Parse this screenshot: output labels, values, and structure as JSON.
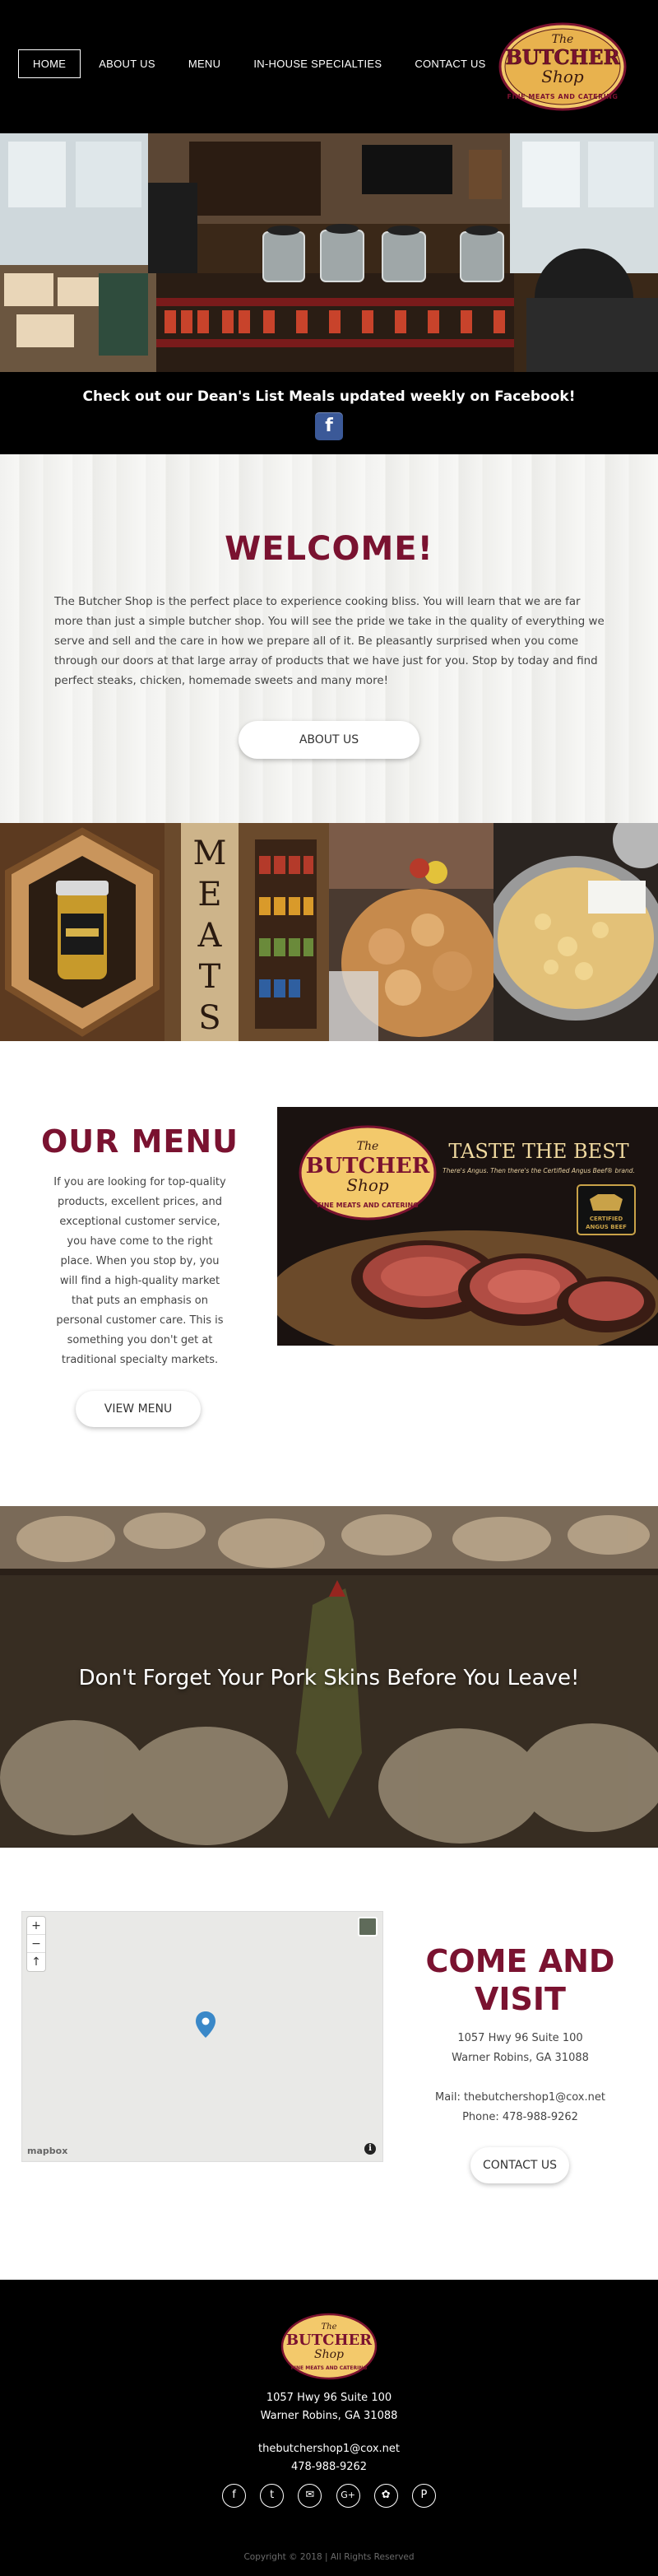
{
  "nav": {
    "items": [
      {
        "label": "HOME",
        "active": true
      },
      {
        "label": "ABOUT US",
        "active": false
      },
      {
        "label": "MENU",
        "active": false
      },
      {
        "label": "IN-HOUSE SPECIALTIES",
        "active": false
      },
      {
        "label": "CONTACT US",
        "active": false
      }
    ]
  },
  "logo": {
    "the": "The",
    "butcher": "BUTCHER",
    "shop": "Shop",
    "tagline": "FINE MEATS AND CATERING"
  },
  "announcement": {
    "text": "Check out our Dean's List Meals updated weekly on Facebook!",
    "facebook_glyph": "f"
  },
  "welcome": {
    "title": "WELCOME!",
    "body": "The Butcher Shop is the perfect place to experience cooking bliss. You will learn that we are far more than just a simple butcher shop. You will see the pride we take in the quality of everything we serve and sell and the care in how we prepare all of it. Be pleasantly surprised when you come through our doors at that large array of products that we have just for you. Stop by today and find perfect steaks, chicken, homemade sweets and many more!",
    "button": "ABOUT US"
  },
  "gallery": {
    "meats_letters": [
      "M",
      "E",
      "A",
      "T",
      "S"
    ]
  },
  "menu_section": {
    "title": "OUR MENU",
    "body": "If you are looking for top-quality products, excellent prices, and exceptional customer service, you have come to the right place. When you stop by, you will find a high-quality market that puts an emphasis on personal customer care. This is something you don't get at traditional specialty markets.",
    "button": "VIEW MENU",
    "banner": {
      "headline": "TASTE THE BEST",
      "subline": "There's Angus. Then there's the Certified Angus Beef® brand.",
      "badge_line1": "CERTIFIED",
      "badge_line2": "ANGUS BEEF"
    }
  },
  "pork": {
    "text": "Don't Forget Your Pork Skins Before You Leave!"
  },
  "visit": {
    "title_line1": "COME AND",
    "title_line2": "VISIT",
    "address_line1": "1057 Hwy 96 Suite 100",
    "address_line2": "Warner Robins, GA  31088",
    "mail": "Mail: thebutchershop1@cox.net",
    "phone": "Phone: 478-988-9262",
    "button": "CONTACT US",
    "map": {
      "zoom_in": "+",
      "zoom_out": "−",
      "compass": "↑",
      "attribution": "mapbox",
      "info": "i"
    }
  },
  "footer": {
    "address_line1": "1057 Hwy 96  Suite 100",
    "address_line2": "Warner Robins, GA  31088",
    "email": "thebutchershop1@cox.net",
    "phone": "478-988-9262",
    "socials": [
      {
        "name": "facebook",
        "glyph": "f"
      },
      {
        "name": "twitter",
        "glyph": "t"
      },
      {
        "name": "email",
        "glyph": "✉"
      },
      {
        "name": "google-plus",
        "glyph": "G+"
      },
      {
        "name": "yelp",
        "glyph": "✿"
      },
      {
        "name": "pinterest",
        "glyph": "P"
      }
    ],
    "copyright": "Copyright © 2018 | All Rights Reserved"
  },
  "colors": {
    "accent": "#7a1230",
    "header_bg": "#000000",
    "facebook": "#3b5998"
  }
}
